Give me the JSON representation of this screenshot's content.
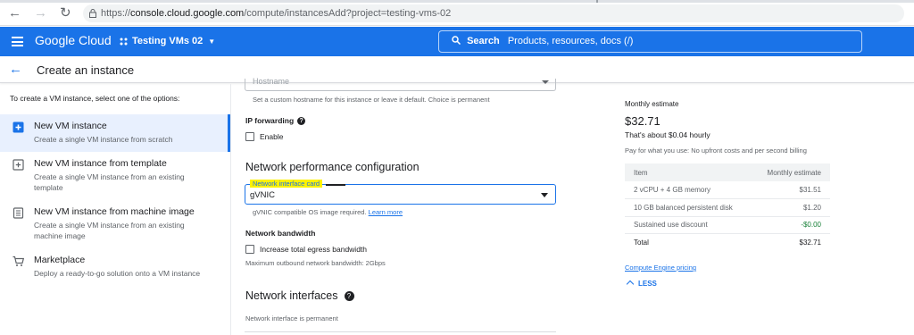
{
  "browser": {
    "url_prefix": "https://",
    "url_host": "console.cloud.google.com",
    "url_path": "/compute/instancesAdd?project=testing-vms-02",
    "back_icon": "←",
    "forward_icon": "→",
    "reload_icon": "↻"
  },
  "appbar": {
    "brand": "Google Cloud",
    "project": "Testing VMs 02",
    "search_label": "Search",
    "search_placeholder": "Products, resources, docs (/)"
  },
  "subheader": {
    "back_icon": "←",
    "title": "Create an instance"
  },
  "left": {
    "intro": "To create a VM instance, select one of the options:",
    "options": [
      {
        "title": "New VM instance",
        "desc": "Create a single VM instance from scratch",
        "icon": "add-box-icon",
        "selected": true
      },
      {
        "title": "New VM instance from template",
        "desc": "Create a single VM instance from an existing template",
        "icon": "template-icon",
        "selected": false
      },
      {
        "title": "New VM instance from machine image",
        "desc": "Create a single VM instance from an existing machine image",
        "icon": "machine-image-icon",
        "selected": false
      },
      {
        "title": "Marketplace",
        "desc": "Deploy a ready-to-go solution onto a VM instance",
        "icon": "cart-icon",
        "selected": false
      }
    ]
  },
  "form": {
    "hostname_placeholder": "Hostname",
    "hostname_hint": "Set a custom hostname for this instance or leave it default. Choice is permanent",
    "ip_forwarding_label": "IP forwarding",
    "ip_forwarding_checkbox": "Enable",
    "ip_forwarding_checked": false,
    "netperf_title": "Network performance configuration",
    "nic_label": "Network interface card",
    "nic_value": "gVNIC",
    "nic_hint": "gVNIC compatible OS image required.",
    "nic_hint_link": "Learn more",
    "bandwidth_label": "Network bandwidth",
    "bandwidth_checkbox": "Increase total egress bandwidth",
    "bandwidth_checked": false,
    "bandwidth_hint": "Maximum outbound network bandwidth: 2Gbps",
    "interfaces_title": "Network interfaces",
    "interfaces_hint": "Network interface is permanent"
  },
  "estimate": {
    "title": "Monthly estimate",
    "price": "$32.71",
    "hourly": "That's about $0.04 hourly",
    "payuse": "Pay for what you use: No upfront costs and per second billing",
    "columns": [
      "Item",
      "Monthly estimate"
    ],
    "rows": [
      {
        "item": "2 vCPU + 4 GB memory",
        "cost": "$31.51"
      },
      {
        "item": "10 GB balanced persistent disk",
        "cost": "$1.20"
      },
      {
        "item": "Sustained use discount",
        "cost": "-$0.00"
      }
    ],
    "total_label": "Total",
    "total_value": "$32.71",
    "pricing_link": "Compute Engine pricing",
    "less_label": "LESS"
  },
  "colors": {
    "accent": "#1a73e8",
    "highlight": "#fef200",
    "discount": "#188038"
  }
}
